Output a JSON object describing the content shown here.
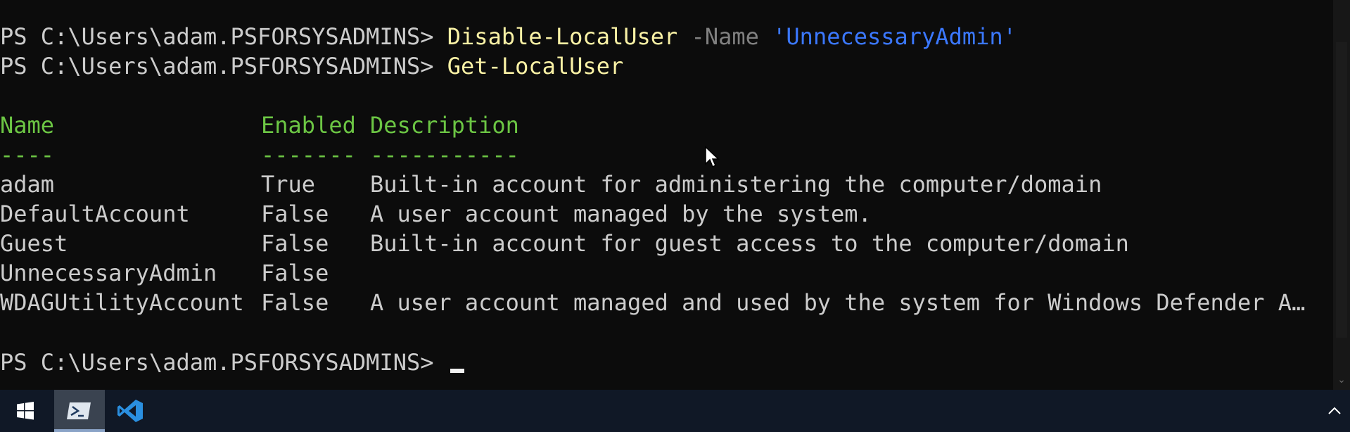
{
  "terminal": {
    "prompt": "PS C:\\Users\\adam.PSFORSYSADMINS> ",
    "line1": {
      "command": "Disable-LocalUser",
      "param": "-Name",
      "arg": "'UnnecessaryAdmin'"
    },
    "line2": {
      "command": "Get-LocalUser"
    },
    "table": {
      "headers": [
        "Name",
        "Enabled",
        "Description"
      ],
      "underlines": [
        "----",
        "-------",
        "-----------"
      ],
      "rows": [
        {
          "name": "adam",
          "enabled": "True",
          "description": "Built-in account for administering the computer/domain"
        },
        {
          "name": "DefaultAccount",
          "enabled": "False",
          "description": "A user account managed by the system."
        },
        {
          "name": "Guest",
          "enabled": "False",
          "description": "Built-in account for guest access to the computer/domain"
        },
        {
          "name": "UnnecessaryAdmin",
          "enabled": "False",
          "description": ""
        },
        {
          "name": "WDAGUtilityAccount",
          "enabled": "False",
          "description": "A user account managed and used by the system for Windows Defender A…"
        }
      ]
    }
  },
  "colors": {
    "background": "#0c0c0c",
    "text": "#cccccc",
    "command": "#f9f1a5",
    "parameter": "#808080",
    "string": "#3b78ff",
    "table_header": "#6cc644",
    "taskbar": "#101826"
  },
  "taskbar": {
    "items": [
      {
        "icon": "windows-start-icon"
      },
      {
        "icon": "powershell-icon",
        "active": true
      },
      {
        "icon": "vscode-icon"
      }
    ],
    "tray_icon": "chevron-up-icon"
  }
}
